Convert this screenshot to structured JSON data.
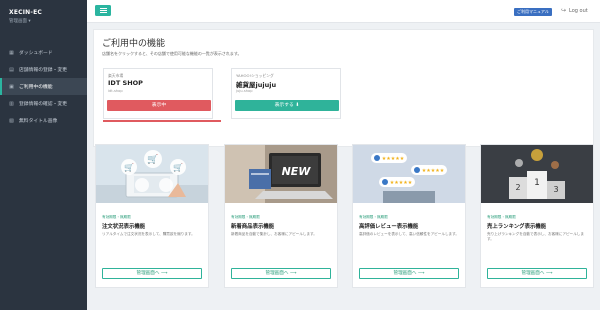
{
  "sidebar": {
    "brand_title": "XECIN-EC",
    "brand_sub": "管理画面 ▾",
    "items": [
      {
        "icon": "▦",
        "label": "ダッシュボード"
      },
      {
        "icon": "▤",
        "label": "店舗情報の登録・変更"
      },
      {
        "icon": "▣",
        "label": "ご利用中の機能"
      },
      {
        "icon": "▥",
        "label": "登録情報の確認・変更"
      },
      {
        "icon": "▧",
        "label": "無料タイトル画像"
      }
    ]
  },
  "topbar": {
    "manual_label": "ご利用マニュアル",
    "logout_icon": "↪",
    "logout_label": "Log out"
  },
  "main": {
    "title": "ご利用中の機能",
    "description": "店舗名をクリックすると、その店舗で使用可能な機能の一覧が表示されます。",
    "shops": [
      {
        "mall": "楽天市場",
        "name": "IDT SHOP",
        "id": "idt-shop",
        "button": "表示中"
      },
      {
        "mall": "YAHOO!ショッピング",
        "name": "雑貨屋jujuju",
        "id": "juju-shop",
        "button": "表示する ⬇"
      }
    ],
    "features": [
      {
        "tag": "有効期限・無期限",
        "title": "注文状況表示機能",
        "desc": "リアルタイムで注文状況を表示して、購買欲を煽ります。",
        "button": "管理画面へ ⟶"
      },
      {
        "tag": "有効期限・無期限",
        "title": "新着商品表示機能",
        "desc": "新着商品を自動で集計し、お客様にアピールします。",
        "button": "管理画面へ ⟶",
        "img_text": "NEW"
      },
      {
        "tag": "有効期限・無期限",
        "title": "高評価レビュー表示機能",
        "desc": "高評価のレビューを表示して、高い信頼性をアピールします。",
        "button": "管理画面へ ⟶"
      },
      {
        "tag": "有効期限・無期限",
        "title": "売上ランキング表示機能",
        "desc": "売り上げランキングを自動で表示し、お客様にアピールします。",
        "button": "管理画面へ ⟶",
        "ranks": [
          "2",
          "1",
          "3"
        ]
      }
    ]
  },
  "colors": {
    "sidebar_bg": "#2b3440",
    "accent_green": "#2fb39a",
    "active_red": "#e05a5f",
    "manual_blue": "#3a6fc1"
  }
}
